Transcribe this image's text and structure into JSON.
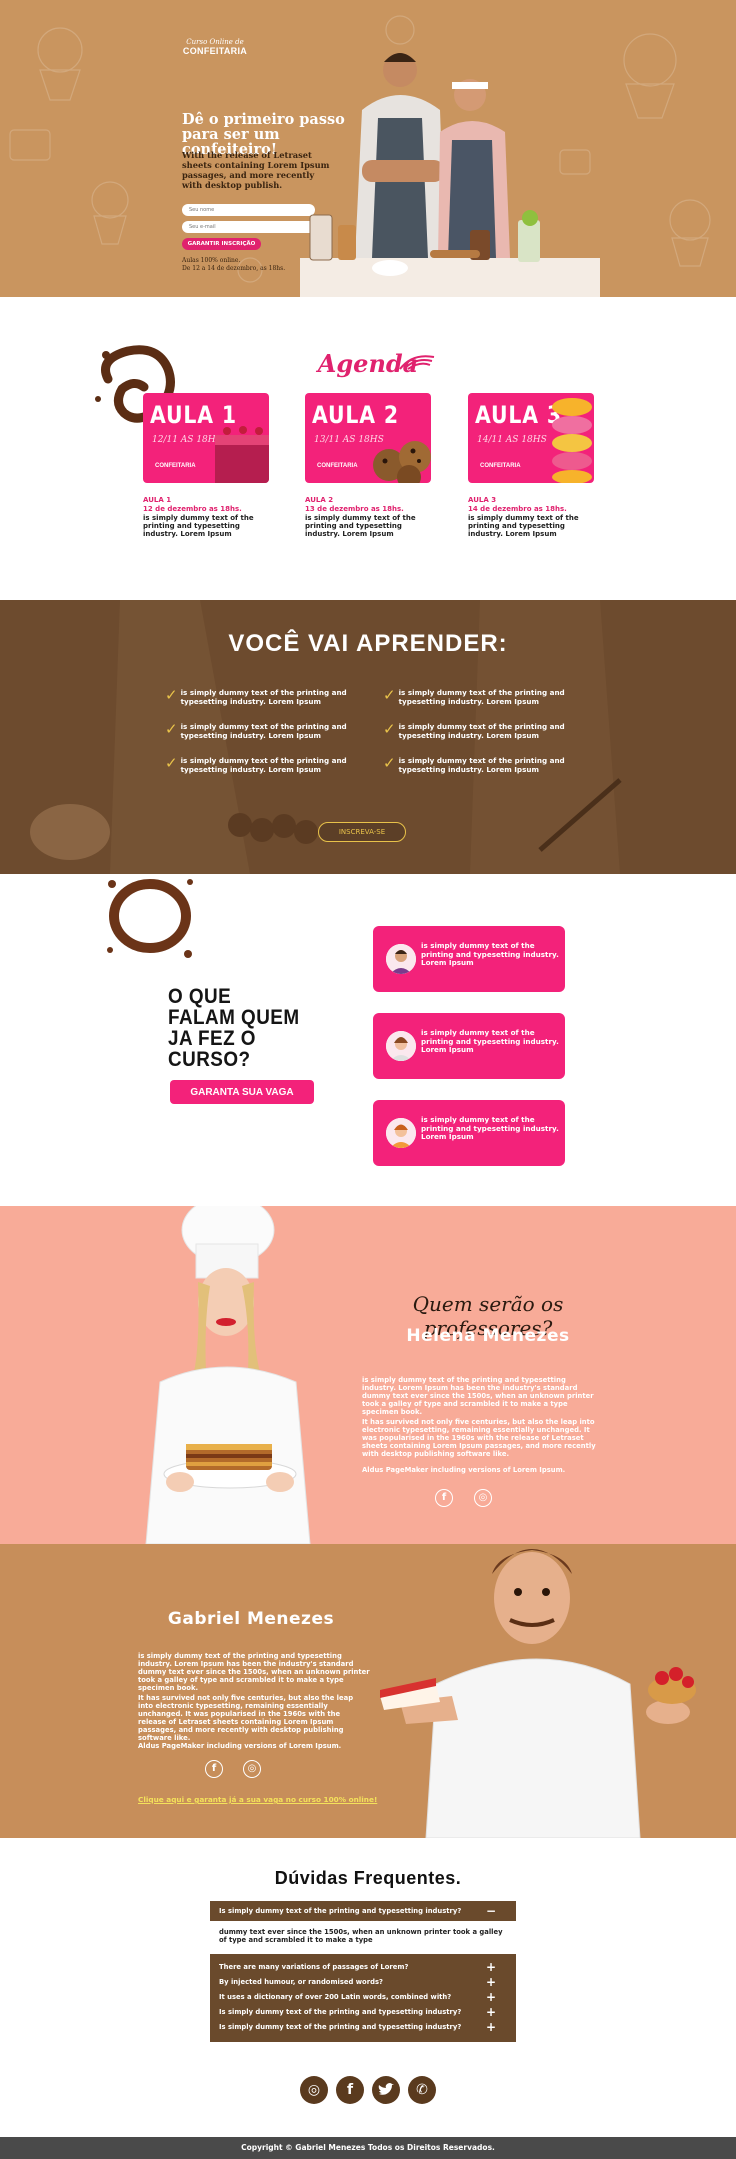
{
  "hero": {
    "logo_top": "Curso Online de",
    "logo_main": "CONFEITARIA",
    "headline": "Dê o primeiro passo para ser um confeiteiro!",
    "subtext": "With the release of Letraset sheets containing Lorem Ipsum passages, and more recently with desktop publish.",
    "name_placeholder": "Seu nome",
    "email_placeholder": "Seu e-mail",
    "cta": "GARANTIR INSCRIÇÃO",
    "schedule_line1": "Aulas 100% online.",
    "schedule_line2": "De 12 a 14 de dezembro, as 18hs."
  },
  "agenda": {
    "title": "Agenda",
    "classes": [
      {
        "card_title": "AULA 1",
        "card_date": "12/11 AS 18HS",
        "card_logo": "CONFEITARIA",
        "label": "AULA 1",
        "date": "12 de dezembro as 18hs.",
        "text": "is simply dummy text of the printing and typesetting industry. Lorem Ipsum"
      },
      {
        "card_title": "AULA 2",
        "card_date": "13/11 AS 18HS",
        "card_logo": "CONFEITARIA",
        "label": "AULA 2",
        "date": "13 de dezembro as 18hs.",
        "text": "is simply dummy text of the printing and typesetting industry. Lorem Ipsum"
      },
      {
        "card_title": "AULA 3",
        "card_date": "14/11 AS 18HS",
        "card_logo": "CONFEITARIA",
        "label": "AULA 3",
        "date": "14 de dezembro as 18hs.",
        "text": "is simply dummy text of the printing and typesetting industry. Lorem Ipsum"
      }
    ]
  },
  "learn": {
    "title": "VOCÊ VAI APRENDER:",
    "items": [
      "is simply dummy text of the printing and typesetting industry. Lorem Ipsum",
      "is simply dummy text of the printing and typesetting industry. Lorem Ipsum",
      "is simply dummy text of the printing and typesetting industry. Lorem Ipsum",
      "is simply dummy text of the printing and typesetting industry. Lorem Ipsum",
      "is simply dummy text of the printing and typesetting industry. Lorem Ipsum",
      "is simply dummy text of the printing and typesetting industry. Lorem Ipsum"
    ],
    "cta": "INSCREVA-SE"
  },
  "testimonials": {
    "title": "O QUE FALAM QUEM JA FEZ O CURSO?",
    "cta": "GARANTA SUA VAGA",
    "items": [
      "is simply dummy text of the printing and typesetting industry. Lorem Ipsum",
      "is simply dummy text of the printing and typesetting industry. Lorem Ipsum",
      "is simply dummy text of the printing and typesetting industry. Lorem Ipsum"
    ]
  },
  "helena": {
    "question": "Quem serão os professores?",
    "name": "Helena Menezes",
    "p1": "is simply dummy text of the printing and typesetting industry. Lorem Ipsum has been the industry's standard dummy text ever since the 1500s, when an unknown printer took a galley of type and scrambled it to make a type specimen book.",
    "p2": "It has survived not only five centuries, but also the leap into electronic typesetting, remaining essentially unchanged. It was popularised in the 1960s with the release of Letraset sheets containing Lorem Ipsum passages, and more recently with desktop publishing software like.",
    "p3": "Aldus PageMaker including versions of Lorem Ipsum."
  },
  "gabriel": {
    "name": "Gabriel Menezes",
    "p1": "is simply dummy text of the printing and typesetting industry. Lorem Ipsum has been the industry's standard dummy text ever since the 1500s, when an unknown printer took a galley of type and scrambled it to make a type specimen book.",
    "p2": "It has survived not only five centuries, but also the leap into electronic typesetting, remaining essentially unchanged. It was popularised in the 1960s with the release of Letraset sheets containing Lorem Ipsum passages, and more recently with desktop publishing software like.",
    "p3": "Aldus PageMaker including versions of Lorem Ipsum.",
    "link": "Clique aqui e garanta já a sua vaga no curso 100% online!"
  },
  "faq": {
    "title": "Dúvidas Frequentes.",
    "open_question": "Is simply dummy text of the printing and typesetting industry?",
    "open_answer": "dummy text ever since the 1500s, when an unknown printer took a galley of type and scrambled it to make a type",
    "questions": [
      "There are many variations of passages of Lorem?",
      "By injected humour, or randomised words?",
      "It uses a dictionary of over 200 Latin words, combined with?",
      "Is simply dummy text of the printing and typesetting industry?",
      "Is simply dummy text of the printing and typesetting industry?"
    ],
    "minus": "−",
    "plus": "+"
  },
  "footer": {
    "copyright": "Copyright © Gabriel Menezes Todos os Direitos Reservados."
  },
  "icons": {
    "social": [
      "instagram-icon",
      "facebook-icon",
      "twitter-icon",
      "whatsapp-icon"
    ]
  },
  "colors": {
    "brand_pink": "#f3227a",
    "hero_bg": "#c9955f",
    "learn_bg": "#6d4b2e",
    "helena_bg": "#f8ab98",
    "gabriel_bg": "#c78e5a",
    "faq_bg": "#6a4a2c"
  }
}
